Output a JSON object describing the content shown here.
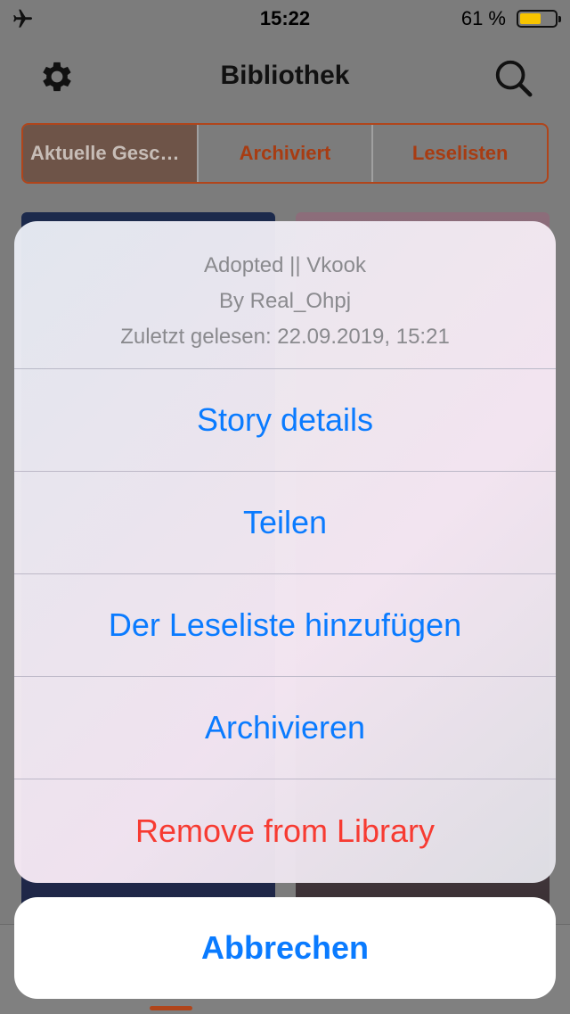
{
  "status_bar": {
    "time": "15:22",
    "battery_percent": "61 %",
    "battery_level": 0.61,
    "airplane_icon": "airplane-icon"
  },
  "header": {
    "title": "Bibliothek",
    "left_icon": "gear-icon",
    "right_icon": "search-icon"
  },
  "tabs": [
    {
      "label": "Aktuelle Gesc…",
      "active": true
    },
    {
      "label": "Archiviert",
      "active": false
    },
    {
      "label": "Leselisten",
      "active": false
    }
  ],
  "action_sheet": {
    "story_title": "Adopted || Vkook",
    "author": "By Real_Ohpj",
    "last_read": "Zuletzt gelesen: 22.09.2019, 15:21",
    "actions": [
      {
        "label": "Story details",
        "style": "default"
      },
      {
        "label": "Teilen",
        "style": "default"
      },
      {
        "label": "Der Leseliste hinzufügen",
        "style": "default"
      },
      {
        "label": "Archivieren",
        "style": "default"
      },
      {
        "label": "Remove from Library",
        "style": "destructive"
      }
    ],
    "cancel_label": "Abbrechen"
  },
  "colors": {
    "accent": "#b0451b",
    "action_blue": "#0a7bff",
    "destructive_red": "#f73b32",
    "battery_yellow": "#f7c400"
  }
}
